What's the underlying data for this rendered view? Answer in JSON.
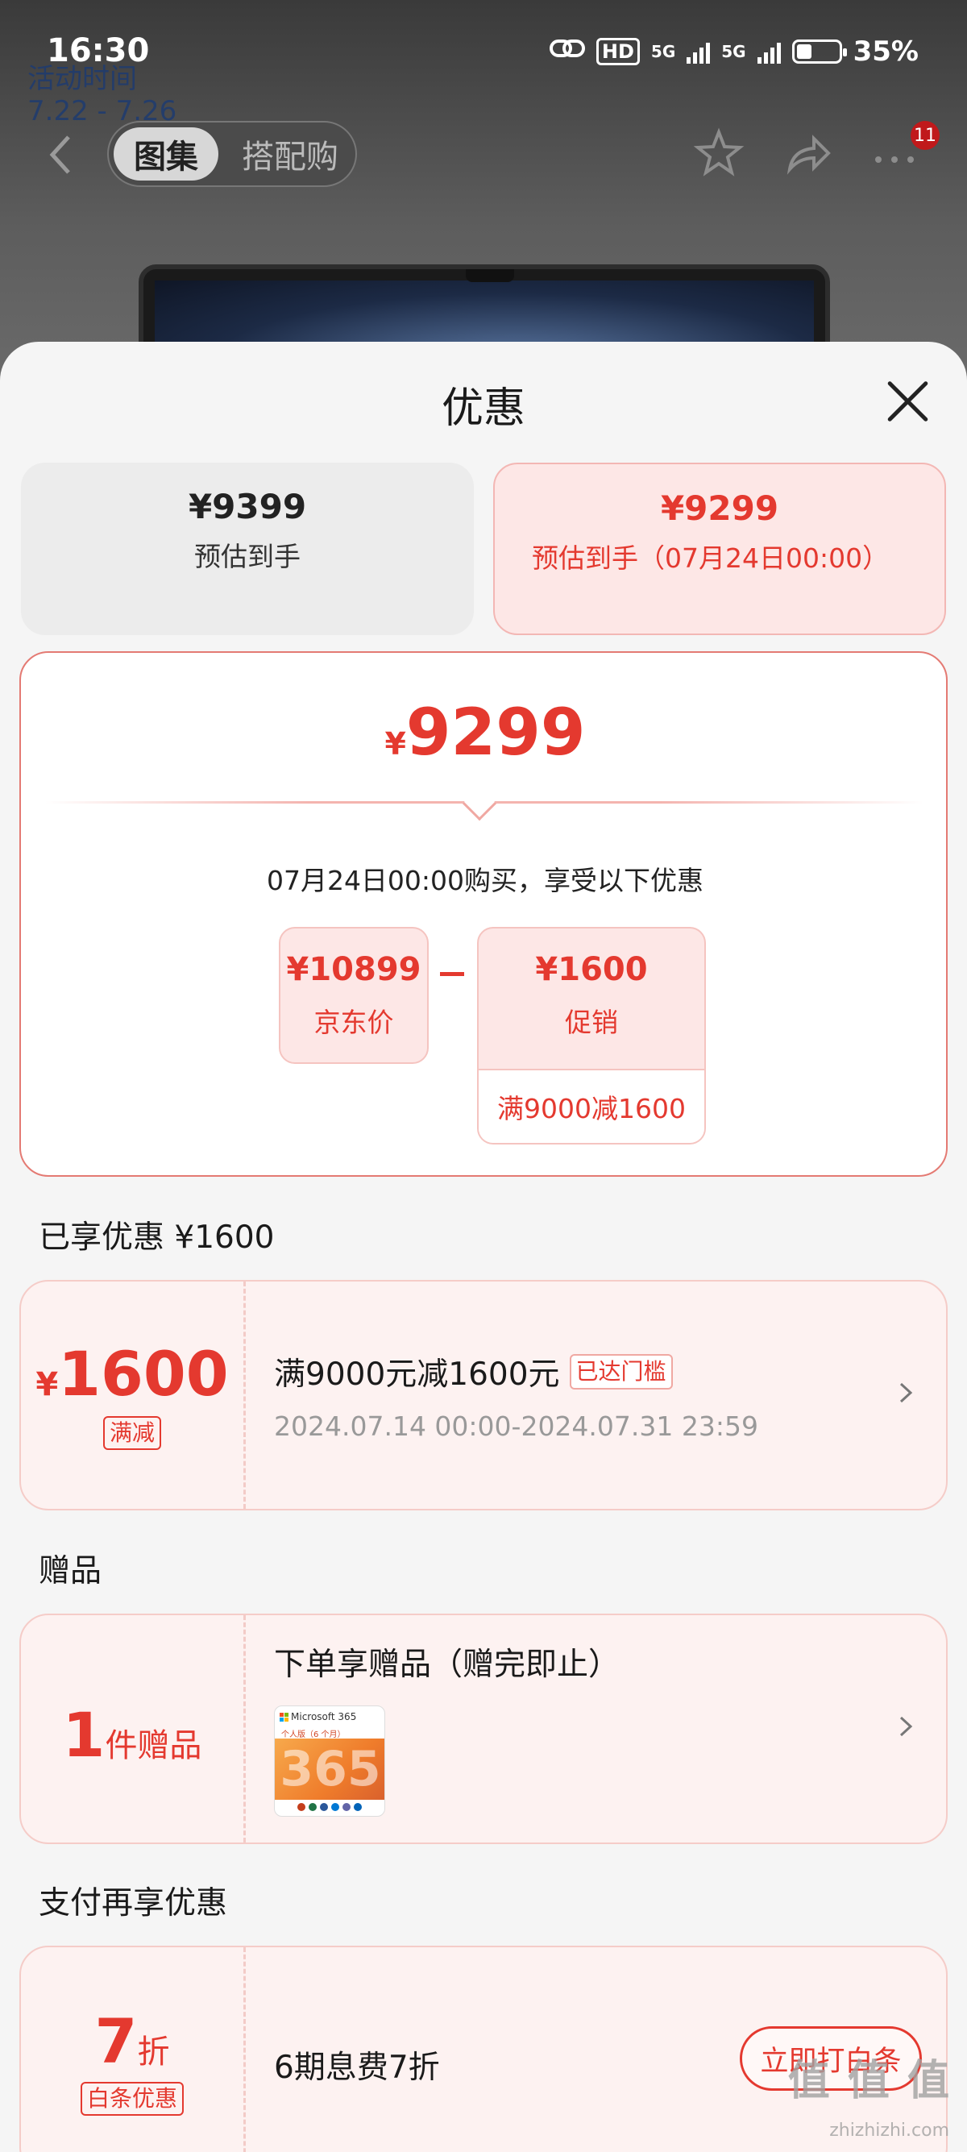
{
  "status_bar": {
    "time": "16:30",
    "hd": "HD",
    "network1": "5G",
    "network2": "5G",
    "battery_percent": "35%",
    "battery_level": 0.35,
    "icons": [
      "link-icon",
      "hd-icon",
      "signal-icon",
      "battery-icon"
    ]
  },
  "background": {
    "activity_time_label": "活动时间",
    "activity_time_range": "7.22 - 7.26",
    "segments": [
      "图集",
      "搭配购"
    ],
    "more_badge": "11",
    "nav_icons": [
      "back-icon",
      "star-icon",
      "share-icon",
      "more-icon"
    ]
  },
  "sheet": {
    "title": "优惠",
    "tabs": [
      {
        "price": "¥9399",
        "label": "预估到手"
      },
      {
        "price": "¥9299",
        "label": "预估到手（07月24日00:00）"
      }
    ],
    "detail": {
      "price_symbol": "¥",
      "price": "9299",
      "note": "07月24日00:00购买，享受以下优惠",
      "jd_price": "¥10899",
      "jd_label": "京东价",
      "promo_price": "¥1600",
      "promo_label": "促销",
      "promo_rule": "满9000减1600"
    },
    "section_discount": "已享优惠 ¥1600",
    "coupon1": {
      "symbol": "¥",
      "amount": "1600",
      "tag": "满减",
      "title": "满9000元减1600元",
      "status": "已达门槛",
      "date": "2024.07.14 00:00-2024.07.31 23:59"
    },
    "section_gift": "赠品",
    "coupon2": {
      "count": "1",
      "unit": "件赠品",
      "title": "下单享赠品（赠完即止）",
      "gift_brand": "Microsoft 365",
      "gift_edition": "个人版（6 个月）",
      "gift_art": "365"
    },
    "section_pay": "支付再享优惠",
    "coupon3": {
      "amount": "7",
      "unit": "折",
      "tag": "白条优惠",
      "title": "6期息费7折",
      "button": "立即打白条"
    },
    "watermark": "值 值 值",
    "watermark_url": "zhizhizhi.com"
  },
  "colors": {
    "accent": "#e4392f",
    "tab_highlight_bg": "#fde7e6",
    "sheet_bg": "#f5f5f5"
  }
}
